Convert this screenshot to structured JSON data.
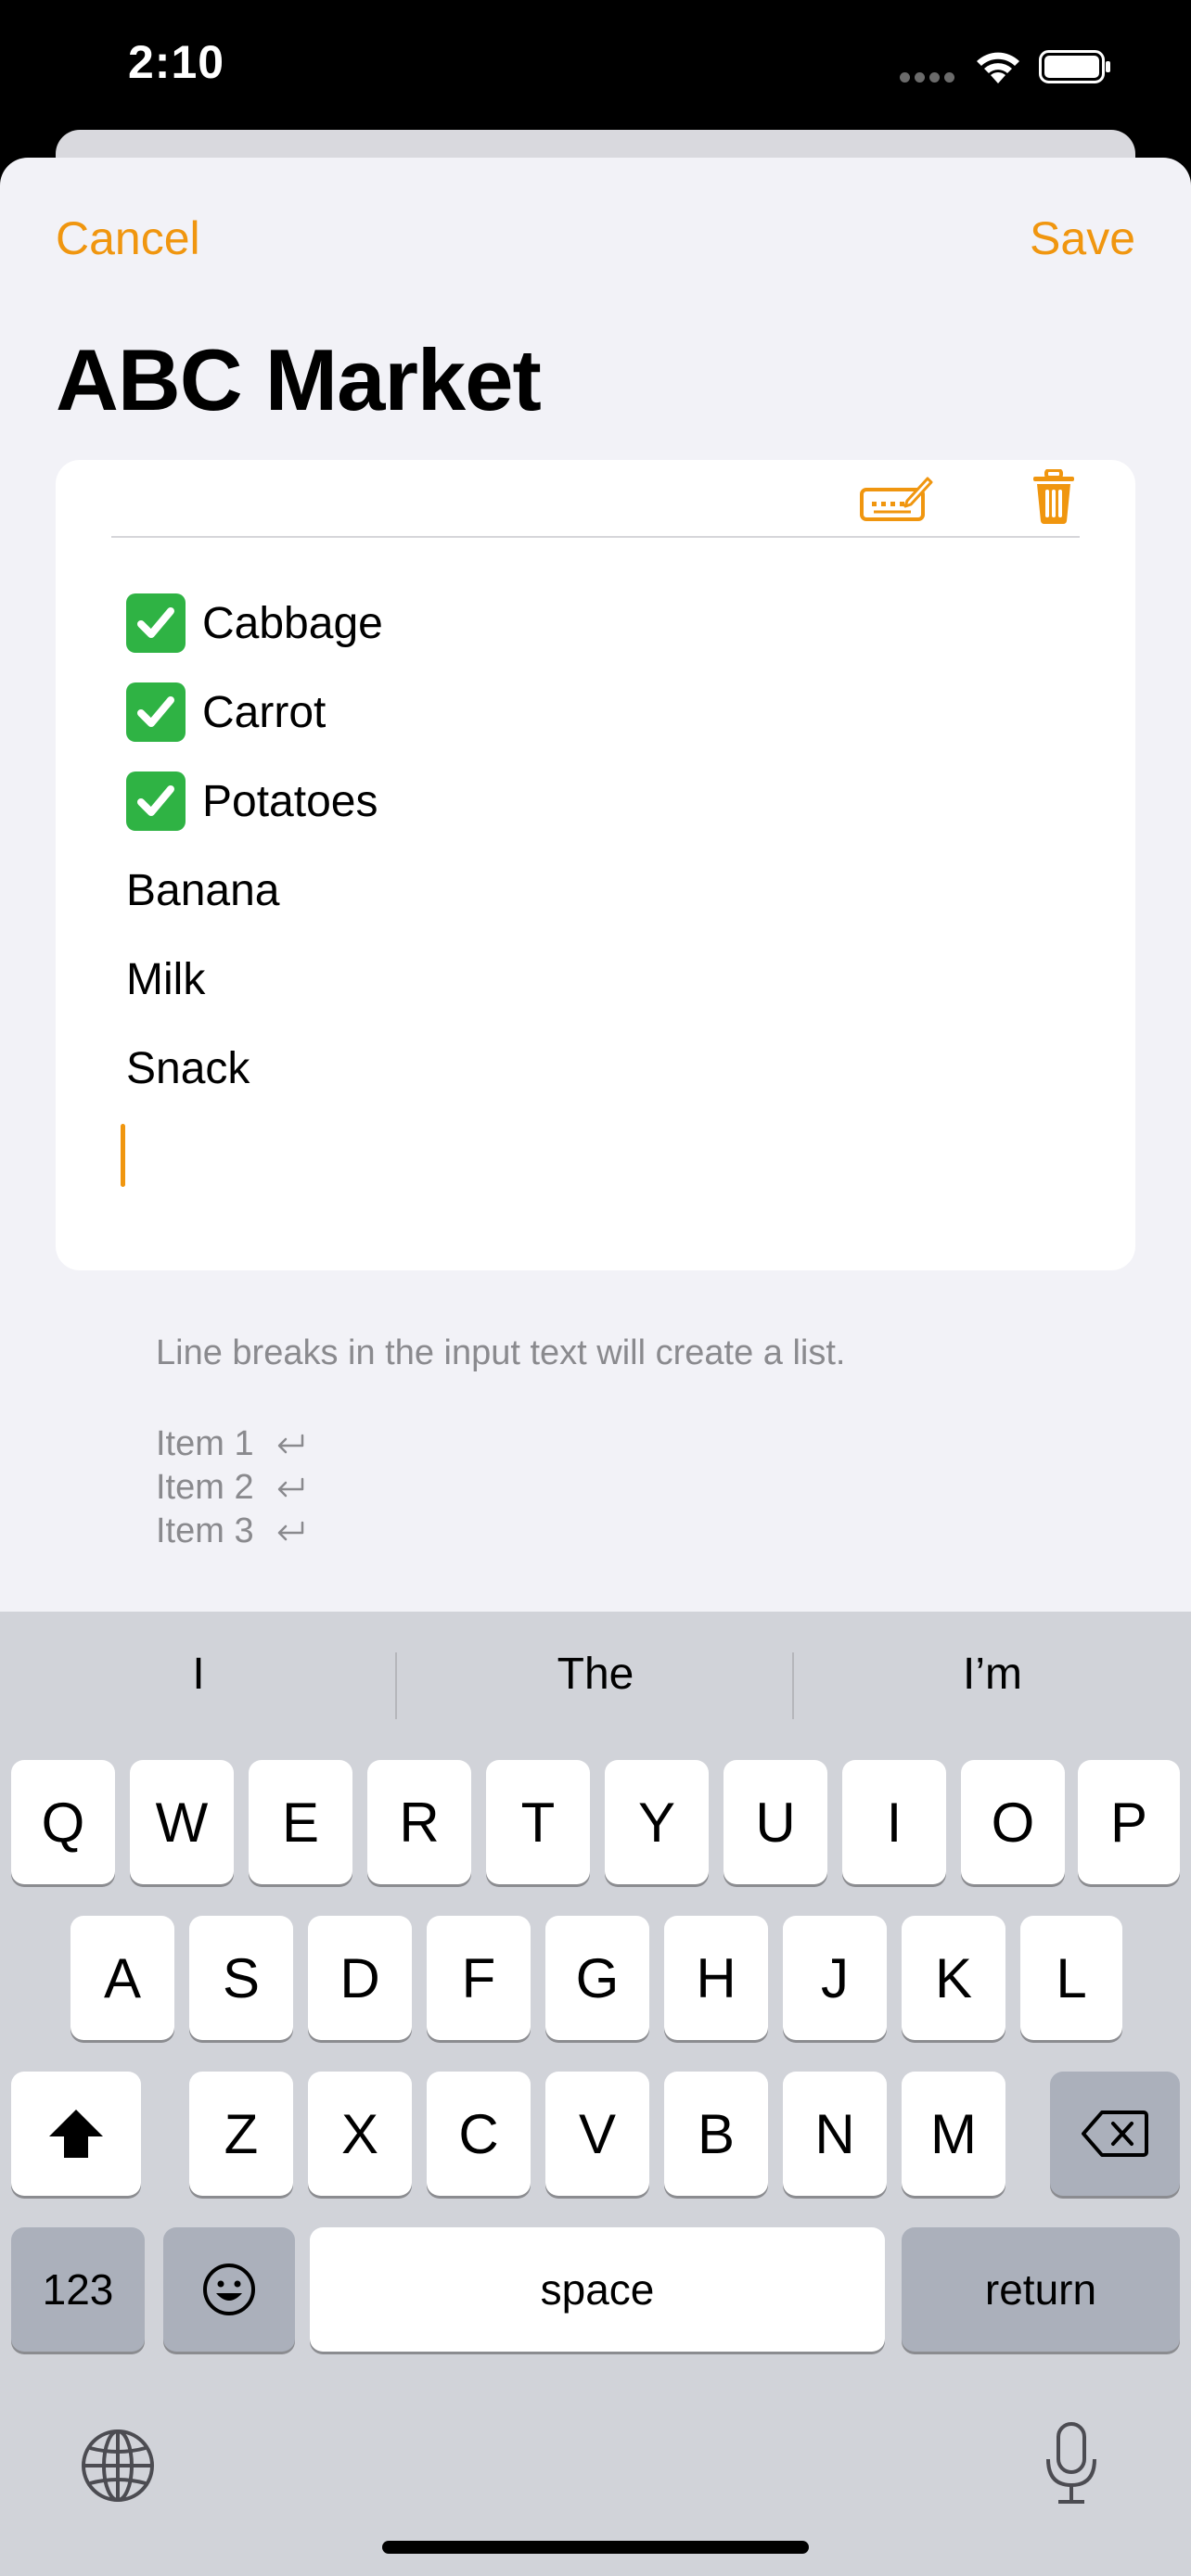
{
  "status_bar": {
    "time": "2:10"
  },
  "nav": {
    "cancel_label": "Cancel",
    "save_label": "Save"
  },
  "page_title": "ABC Market",
  "list": {
    "items": [
      {
        "text": "Cabbage",
        "checked": true
      },
      {
        "text": "Carrot",
        "checked": true
      },
      {
        "text": "Potatoes",
        "checked": true
      },
      {
        "text": "Banana",
        "checked": false
      },
      {
        "text": "Milk",
        "checked": false
      },
      {
        "text": "Snack",
        "checked": false
      }
    ]
  },
  "hint": "Line breaks in the input text will create a list.",
  "example_items": [
    "Item 1",
    "Item 2",
    "Item 3"
  ],
  "keyboard": {
    "suggestions": [
      "I",
      "The",
      "I’m"
    ],
    "row1": [
      "Q",
      "W",
      "E",
      "R",
      "T",
      "Y",
      "U",
      "I",
      "O",
      "P"
    ],
    "row2": [
      "A",
      "S",
      "D",
      "F",
      "G",
      "H",
      "J",
      "K",
      "L"
    ],
    "row3": [
      "Z",
      "X",
      "C",
      "V",
      "B",
      "N",
      "M"
    ],
    "numbers_label": "123",
    "space_label": "space",
    "return_label": "return"
  },
  "colors": {
    "accent": "#f0960f",
    "check_green": "#2fb344",
    "sheet_bg": "#f2f2f7"
  },
  "icons": [
    "wifi-icon",
    "battery-icon",
    "keyboard-edit-icon",
    "trash-icon",
    "checkmark-icon",
    "return-icon",
    "shift-icon",
    "delete-icon",
    "emoji-icon",
    "globe-icon",
    "microphone-icon"
  ]
}
